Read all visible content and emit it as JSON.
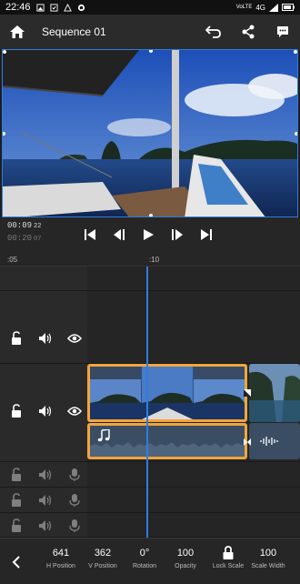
{
  "status_bar": {
    "time": "22:46",
    "network": "4G",
    "network_sub": "LTE",
    "volte": "VoLTE"
  },
  "app_bar": {
    "title": "Sequence 01",
    "icons": [
      "home-icon",
      "undo-icon",
      "share-icon",
      "comment-icon"
    ]
  },
  "playback": {
    "current_time": "00:09",
    "current_frame": "22",
    "total_time": "00:20",
    "total_frame": "07"
  },
  "ruler": {
    "ticks": [
      ":05",
      ":10"
    ]
  },
  "toolbar": {
    "items": [
      {
        "value": "641",
        "label": "H Position"
      },
      {
        "value": "362",
        "label": "V Position"
      },
      {
        "value": "0°",
        "label": "Rotation"
      },
      {
        "value": "100",
        "label": "Opacity"
      },
      {
        "value": "",
        "label": "Lock Scale"
      },
      {
        "value": "100",
        "label": "Scale Width"
      }
    ]
  },
  "colors": {
    "accent": "#2f7de1",
    "clip_selected": "#f2a53c",
    "audio_clip": "#3a4d63"
  }
}
